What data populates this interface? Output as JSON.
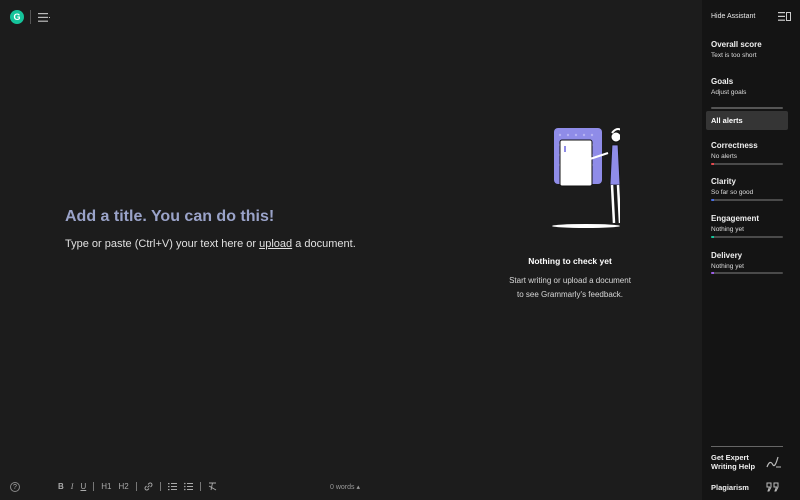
{
  "app": {
    "logo_letter": "G",
    "accent": "#15c39a"
  },
  "editor": {
    "title_placeholder": "Add a title. You can do this!",
    "body_pre": "Type or paste (Ctrl+V) your text here or ",
    "body_link": "upload",
    "body_post": " a document."
  },
  "empty_state": {
    "title": "Nothing to check yet",
    "line1": "Start writing or upload a document",
    "line2": "to see Grammarly's feedback."
  },
  "sidebar": {
    "hide_label": "Hide Assistant",
    "overall": {
      "title": "Overall score",
      "sub": "Text is too short"
    },
    "goals": {
      "title": "Goals",
      "sub": "Adjust goals"
    },
    "all_alerts": "All alerts",
    "correctness": {
      "title": "Correctness",
      "sub": "No alerts",
      "color": "#e5484d"
    },
    "clarity": {
      "title": "Clarity",
      "sub": "So far so good",
      "color": "#4a6ee0"
    },
    "engagement": {
      "title": "Engagement",
      "sub": "Nothing yet",
      "color": "#15c39a"
    },
    "delivery": {
      "title": "Delivery",
      "sub": "Nothing yet",
      "color": "#9b5de5"
    },
    "expert": "Get Expert Writing Help",
    "plagiarism": "Plagiarism"
  },
  "toolbar": {
    "bold": "B",
    "italic": "I",
    "underline": "U",
    "h1": "H1",
    "h2": "H2",
    "word_count": "0 words"
  },
  "help": "?"
}
